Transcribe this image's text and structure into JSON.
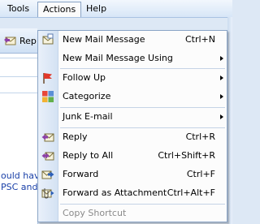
{
  "menubar": {
    "tools": "Tools",
    "actions": "Actions",
    "help": "Help"
  },
  "toolbar": {
    "reply_partial": "Rep",
    "icon": "reply-icon"
  },
  "background_text": {
    "line1": "ould have",
    "line2": "PSC and a"
  },
  "menu": {
    "items": [
      {
        "label": "New Mail Message",
        "shortcut": "Ctrl+N",
        "icon": "new-mail-icon"
      },
      {
        "label": "New Mail Message Using",
        "shortcut": "",
        "icon": "",
        "submenu": true
      },
      {
        "label": "Follow Up",
        "shortcut": "",
        "icon": "red-flag-icon",
        "submenu": true
      },
      {
        "label": "Categorize",
        "shortcut": "",
        "icon": "color-categories-icon",
        "submenu": true
      },
      {
        "label": "Junk E-mail",
        "shortcut": "",
        "icon": "",
        "submenu": true
      },
      {
        "label": "Reply",
        "shortcut": "Ctrl+R",
        "icon": "reply-icon"
      },
      {
        "label": "Reply to All",
        "shortcut": "Ctrl+Shift+R",
        "icon": "reply-all-icon"
      },
      {
        "label": "Forward",
        "shortcut": "Ctrl+F",
        "icon": "forward-icon"
      },
      {
        "label": "Forward as Attachment",
        "shortcut": "Ctrl+Alt+F",
        "icon": "forward-attachment-icon"
      },
      {
        "label": "Copy Shortcut",
        "shortcut": "",
        "icon": "",
        "disabled": true
      }
    ]
  },
  "colors": {
    "flag": "#e0382a",
    "accent": "#2b5fb8",
    "link": "#1a40a8"
  }
}
